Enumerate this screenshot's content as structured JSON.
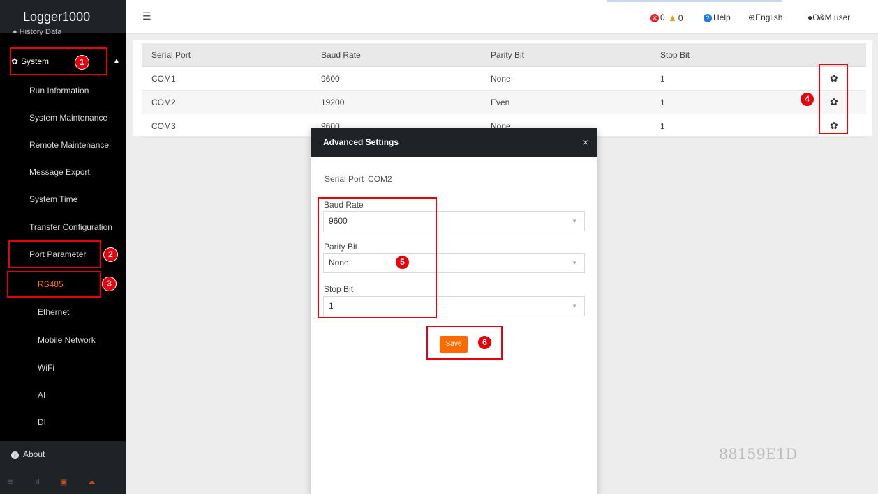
{
  "app": {
    "title": "Logger1000"
  },
  "sidebar": {
    "history_label": "History Data",
    "system_label": "System",
    "items": [
      {
        "label": "Run Information"
      },
      {
        "label": "System Maintenance"
      },
      {
        "label": "Remote Maintenance"
      },
      {
        "label": "Message Export"
      },
      {
        "label": "System Time"
      },
      {
        "label": "Transfer Configuration"
      },
      {
        "label": "Port Parameter"
      }
    ],
    "port_items": [
      {
        "label": "RS485"
      },
      {
        "label": "Ethernet"
      },
      {
        "label": "Mobile Network"
      },
      {
        "label": "WiFi"
      },
      {
        "label": "AI"
      },
      {
        "label": "DI"
      }
    ],
    "about_label": "About"
  },
  "topbar": {
    "error_count": "0",
    "warning_count": "0",
    "help_label": "Help",
    "language_label": "English",
    "user_label": "O&M user"
  },
  "table": {
    "headers": [
      "Serial Port",
      "Baud Rate",
      "Parity Bit",
      "Stop Bit"
    ],
    "rows": [
      [
        "COM1",
        "9600",
        "None",
        "1"
      ],
      [
        "COM2",
        "19200",
        "Even",
        "1"
      ],
      [
        "COM3",
        "9600",
        "None",
        "1"
      ]
    ]
  },
  "modal": {
    "title": "Advanced Settings",
    "close": "×",
    "serial_port_label": "Serial Port",
    "serial_port_value": "COM2",
    "baud_rate_label": "Baud Rate",
    "baud_rate_value": "9600",
    "parity_label": "Parity Bit",
    "parity_value": "None",
    "stop_bit_label": "Stop Bit",
    "stop_bit_value": "1",
    "save_label": "Save"
  },
  "annotations": [
    "1",
    "2",
    "3",
    "4",
    "5",
    "6"
  ],
  "watermark": "88159E1D",
  "colors": {
    "accent": "#ff6a00",
    "highlight": "#e8000a",
    "sidebar": "#000000"
  }
}
